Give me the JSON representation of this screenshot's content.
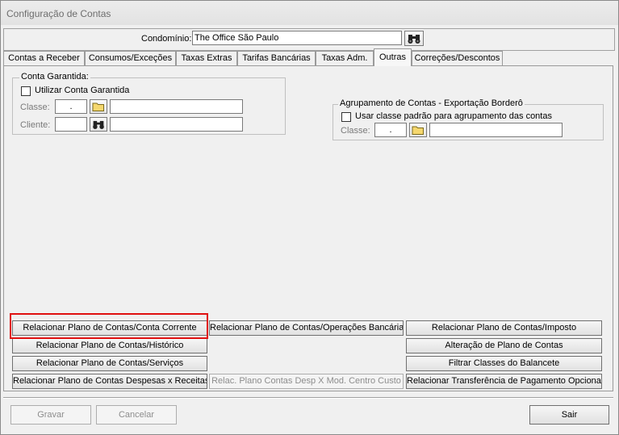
{
  "window": {
    "title": "Configuração de Contas"
  },
  "header": {
    "condominio_label": "Condomínio:",
    "condominio_value": "The Office São Paulo"
  },
  "tabs": [
    {
      "label": "Contas a Receber"
    },
    {
      "label": "Consumos/Exceções"
    },
    {
      "label": "Taxas Extras"
    },
    {
      "label": "Tarifas Bancárias"
    },
    {
      "label": "Taxas Adm."
    },
    {
      "label": "Outras"
    },
    {
      "label": "Correções/Descontos"
    }
  ],
  "active_tab": "Outras",
  "conta_garantida": {
    "legend": "Conta Garantida:",
    "checkbox_label": "Utilizar Conta Garantida",
    "checked": false,
    "classe_label": "Classe:",
    "classe_code": ".",
    "classe_desc": "",
    "cliente_label": "Cliente:",
    "cliente_code": "",
    "cliente_desc": ""
  },
  "agrupamento": {
    "legend": "Agrupamento de Contas - Exportação Borderô",
    "checkbox_label": "Usar classe padrão para agrupamento das contas",
    "checked": false,
    "classe_label": "Classe:",
    "classe_code": ".",
    "classe_desc": ""
  },
  "actions": {
    "col1": [
      "Relacionar Plano de Contas/Conta Corrente",
      "Relacionar Plano de Contas/Histórico",
      "Relacionar Plano de Contas/Serviços",
      "Relacionar Plano de Contas Despesas x Receitas"
    ],
    "col2": [
      "Relacionar Plano de Contas/Operações Bancárias",
      "Relac. Plano Contas Desp X Mod. Centro Custo"
    ],
    "col3": [
      "Relacionar Plano de Contas/Imposto",
      "Alteração de Plano de Contas",
      "Filtrar Classes do Balancete",
      "Relacionar Transferência de Pagamento Opcional"
    ]
  },
  "footer": {
    "gravar": "Gravar",
    "cancelar": "Cancelar",
    "sair": "Sair"
  },
  "colors": {
    "highlight": "#e01010",
    "folder": "#f5d76e"
  },
  "icons": {
    "search": "binoculars-icon",
    "folder": "folder-icon"
  }
}
